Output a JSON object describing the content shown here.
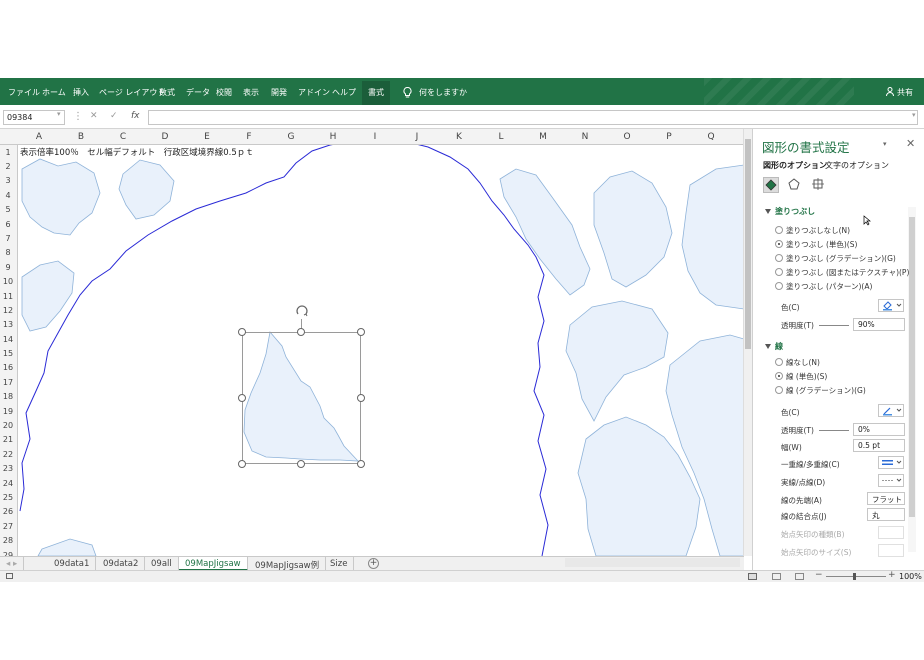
{
  "ribbon": {
    "tabs": [
      "ファイル",
      "ホーム",
      "挿入",
      "ページ レイアウト",
      "数式",
      "データ",
      "校閲",
      "表示",
      "開発",
      "アドイン",
      "ヘルプ",
      "書式"
    ],
    "active_tab": "書式",
    "search_placeholder": "何をしますか",
    "share_label": "共有"
  },
  "formula_bar": {
    "name_box": "09384",
    "cancel_glyph": "✕",
    "enter_glyph": "✓",
    "fx_label": "fx",
    "content": ""
  },
  "sheet": {
    "columns": [
      "A",
      "B",
      "C",
      "D",
      "E",
      "F",
      "G",
      "H",
      "I",
      "J",
      "K",
      "L",
      "M",
      "N",
      "O",
      "P",
      "Q"
    ],
    "rows": [
      "1",
      "2",
      "3",
      "4",
      "5",
      "6",
      "7",
      "8",
      "9",
      "10",
      "11",
      "12",
      "13",
      "14",
      "15",
      "16",
      "17",
      "18",
      "19",
      "20",
      "21",
      "22",
      "23",
      "24",
      "25",
      "26",
      "27",
      "28",
      "29"
    ],
    "a1_text": "表示倍率100％　セル幅デフォルト　行政区域境界線0.5ｐｔ"
  },
  "sheet_tabs": [
    "09data1",
    "09data2",
    "09all",
    "09MapJigsaw",
    "09MapJigsaw例",
    "Size"
  ],
  "active_sheet": "09MapJigsaw",
  "status_bar": {
    "zoom": "100%"
  },
  "format_pane": {
    "title": "図形の書式設定",
    "tab_shape": "図形のオプション",
    "tab_text": "文字のオプション",
    "fill_section": "塗りつぶし",
    "fill_options": [
      "塗りつぶしなし(N)",
      "塗りつぶし (単色)(S)",
      "塗りつぶし (グラデーション)(G)",
      "塗りつぶし (図またはテクスチャ)(P)",
      "塗りつぶし (パターン)(A)"
    ],
    "fill_selected_index": 1,
    "fill_color_label": "色(C)",
    "fill_transparency_label": "透明度(T)",
    "fill_transparency_value": "90%",
    "line_section": "線",
    "line_options": [
      "線なし(N)",
      "線 (単色)(S)",
      "線 (グラデーション)(G)"
    ],
    "line_selected_index": 1,
    "line_color_label": "色(C)",
    "line_transparency_label": "透明度(T)",
    "line_transparency_value": "0%",
    "width_label": "幅(W)",
    "width_value": "0.5 pt",
    "compound_label": "一重線/多重線(C)",
    "dash_label": "実線/点線(D)",
    "cap_label": "線の先端(A)",
    "cap_value": "フラット",
    "join_label": "線の結合点(J)",
    "join_value": "丸",
    "begin_arrow_type_label": "始点矢印の種類(B)",
    "begin_arrow_size_label": "始点矢印のサイズ(S)"
  },
  "colors": {
    "accent": "#217346",
    "map_fill": "#e9f1fb",
    "map_stroke": "#8fb3d9",
    "boundary": "#2a2ad6",
    "selection_handle": "#666666"
  }
}
